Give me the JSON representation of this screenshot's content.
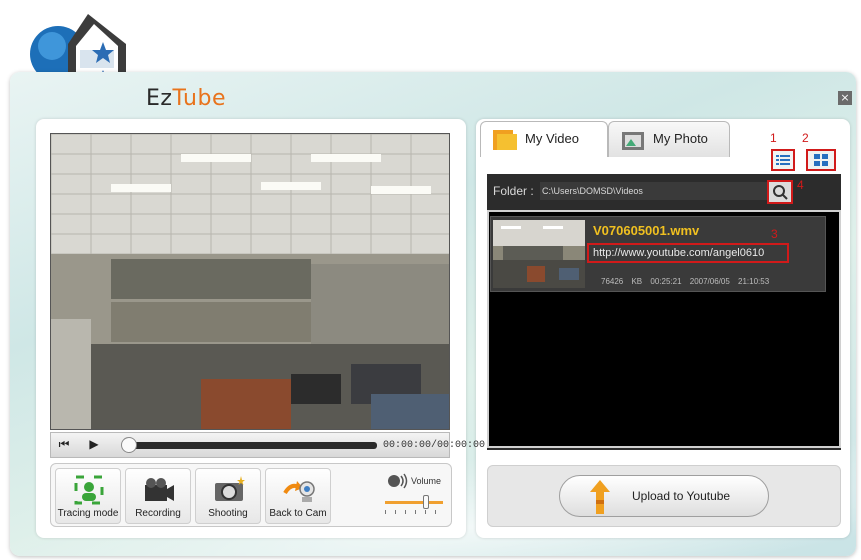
{
  "app": {
    "title_part1": "Ez",
    "title_part2": "Tube",
    "close_label": "×"
  },
  "player": {
    "time": "00:00:00/00:00:00",
    "prev_label": "⏮",
    "play_label": "▶"
  },
  "tools": [
    {
      "label": "Tracing mode",
      "icon": "face-tracking-icon"
    },
    {
      "label": "Recording",
      "icon": "video-camera-icon"
    },
    {
      "label": "Shooting",
      "icon": "photo-camera-icon"
    },
    {
      "label": "Back to Cam",
      "icon": "webcam-icon"
    }
  ],
  "volume": {
    "label": "Volume",
    "level": 0.7
  },
  "tabs": [
    {
      "label": "My Video",
      "icon": "video-folder-icon",
      "active": true
    },
    {
      "label": "My Photo",
      "icon": "photo-folder-icon",
      "active": false
    }
  ],
  "annotations": {
    "a1": "1",
    "a2": "2",
    "a3": "3",
    "a4": "4"
  },
  "folder": {
    "label": "Folder :",
    "path": "C:\\Users\\DOMSD\\Videos"
  },
  "videos": [
    {
      "name": "V070605001.wmv",
      "url": "http://www.youtube.com/angel0610",
      "size": "76426 KB",
      "duration": "00:25:21",
      "date": "2007/06/05 21:10:53"
    }
  ],
  "upload": {
    "label": "Upload to Youtube"
  },
  "colors": {
    "accent": "#e8731c",
    "highlight": "#d11a1a",
    "video_name": "#f0c020"
  }
}
